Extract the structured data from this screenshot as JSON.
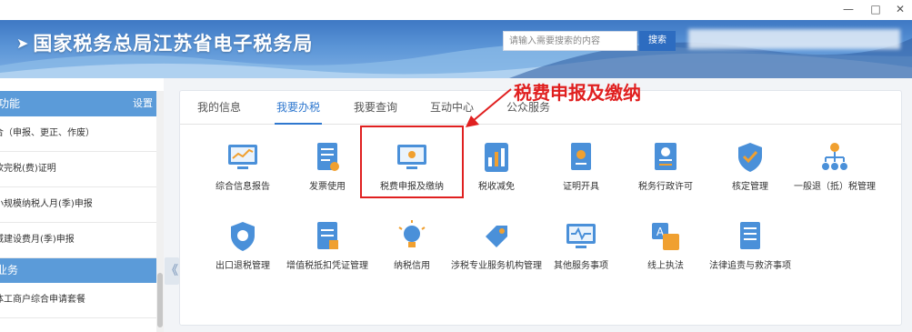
{
  "window": {
    "minimize": "—",
    "maximize": "□",
    "close": "✕"
  },
  "banner": {
    "title": "国家税务总局江苏省电子税务局",
    "search_placeholder": "请输入需要搜索的内容",
    "search_button": "搜索"
  },
  "sidebar": {
    "section1_title": "功能",
    "settings": "设置",
    "items": [
      "合（申报、更正、作废）",
      "款完税(费)证明",
      "小规模纳税人月(季)申报",
      "城建设费月(季)申报"
    ],
    "section2_title": "业务",
    "items2": [
      "体工商户综合申请套餐"
    ]
  },
  "collapse_glyph": "《",
  "tabs": [
    "我的信息",
    "我要办税",
    "我要查询",
    "互动中心",
    "公众服务"
  ],
  "tiles_row1": [
    {
      "label": "综合信息报告",
      "icon": "chart-monitor-icon"
    },
    {
      "label": "发票使用",
      "icon": "invoice-doc-icon"
    },
    {
      "label": "税费申报及缴纳",
      "icon": "monitor-declare-icon"
    },
    {
      "label": "税收减免",
      "icon": "bar-chart-icon"
    },
    {
      "label": "证明开具",
      "icon": "certificate-icon"
    },
    {
      "label": "税务行政许可",
      "icon": "license-icon"
    },
    {
      "label": "核定管理",
      "icon": "shield-check-icon"
    },
    {
      "label": "一般退（抵）税管理",
      "icon": "org-tree-icon"
    }
  ],
  "tiles_row2": [
    {
      "label": "出口退税管理",
      "icon": "shield-icon"
    },
    {
      "label": "增值税抵扣凭证管理",
      "icon": "document-icon"
    },
    {
      "label": "纳税信用",
      "icon": "lightbulb-icon"
    },
    {
      "label": "涉税专业服务机构管理",
      "icon": "tag-icon"
    },
    {
      "label": "其他服务事项",
      "icon": "monitor-wave-icon"
    },
    {
      "label": "线上执法",
      "icon": "translate-icon"
    },
    {
      "label": "法律追责与救济事项",
      "icon": "legal-doc-icon"
    }
  ],
  "annotation": "税费申报及缴纳",
  "colors": {
    "primary": "#2f78cf",
    "highlight": "#e02020",
    "sidebar": "#5b9bd9"
  }
}
